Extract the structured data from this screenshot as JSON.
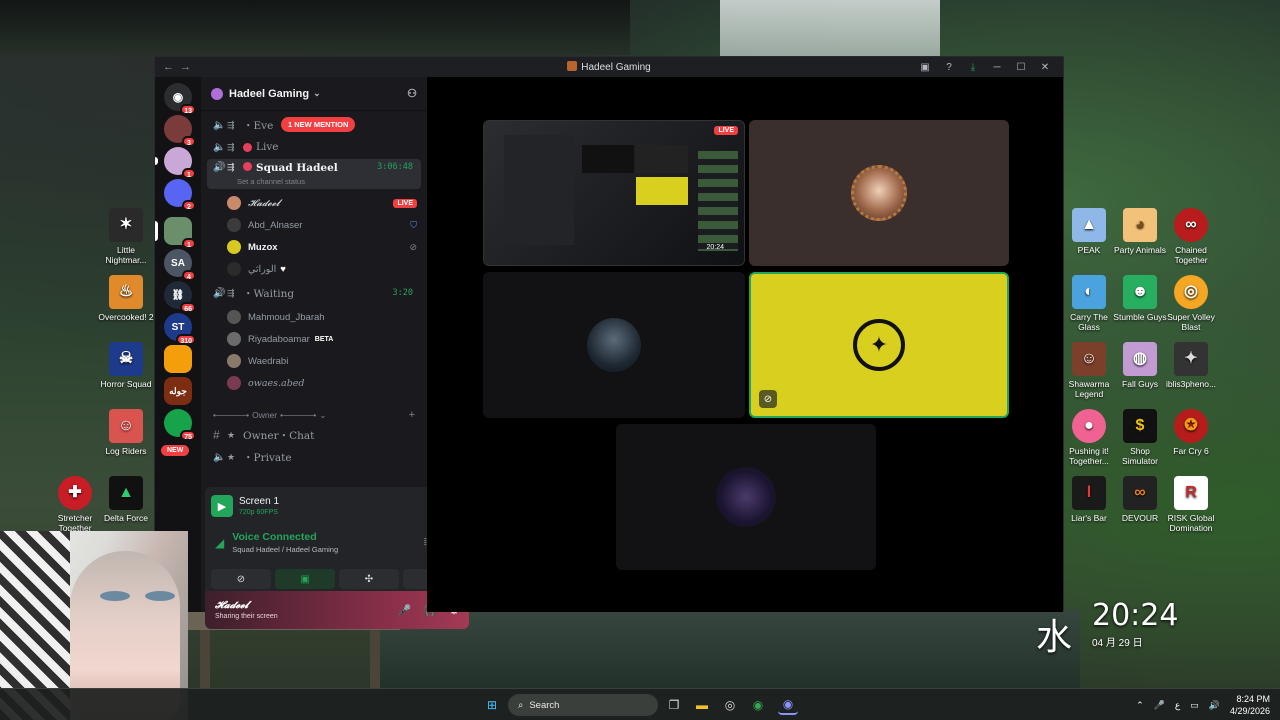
{
  "window": {
    "title": "Hadeel Gaming",
    "nav_back": "←",
    "nav_forward": "→",
    "controls": [
      "minimize",
      "maximize",
      "close"
    ]
  },
  "rail": {
    "servers": [
      {
        "label": "",
        "badge": "13",
        "color": "#5865f2"
      },
      {
        "label": "",
        "badge": "3",
        "color": "#7a3b3b"
      },
      {
        "label": "",
        "badge": "1",
        "color": "#c9a7d6"
      },
      {
        "label": "",
        "badge": "2",
        "color": "#5865f2"
      },
      {
        "label": "",
        "badge": "1",
        "color": "#6a8f6a"
      },
      {
        "label": "SA",
        "badge": "4",
        "color": "#4b5563"
      },
      {
        "label": "",
        "badge": "66",
        "color": "#1f2937"
      },
      {
        "label": "ST",
        "badge": "310",
        "color": "#1e3a8a"
      },
      {
        "label": "",
        "badge": "",
        "color": "#f59e0b"
      },
      {
        "label": "جوله",
        "badge": "",
        "color": "#7c2d12"
      },
      {
        "label": "",
        "badge": "75",
        "color": "#16a34a"
      }
    ],
    "new_label": "NEW"
  },
  "guild": {
    "name": "Hadeel Gaming",
    "mention_pill": "1 NEW MENTION",
    "channels": [
      {
        "name": "・Eve",
        "type": "voice"
      },
      {
        "name": "Live",
        "type": "voice"
      },
      {
        "name": "Squad Hadeel",
        "type": "voice",
        "time": "3:06:48",
        "status": "Set a channel status"
      },
      {
        "name": "・Waiting",
        "type": "voice",
        "time": "3:20"
      }
    ],
    "squad_members": [
      {
        "name": "𝓗𝓪𝓭𝓮𝓮𝓵",
        "badge": "LIVE"
      },
      {
        "name": "Abd_Alnaser",
        "badge": ""
      },
      {
        "name": "Muzox",
        "badge": ""
      },
      {
        "name": "الوراثي",
        "badge": ""
      }
    ],
    "waiting_members": [
      {
        "name": "Mahmoud_Jbarah"
      },
      {
        "name": "Riyadaboamar",
        "beta": "BETA"
      },
      {
        "name": "Waedrabi"
      },
      {
        "name": "owaes.abed"
      }
    ],
    "category": "Owner",
    "text_channel": "Owner・Chat",
    "private_channel": "・Private"
  },
  "voice_panel": {
    "screen_title": "Screen 1",
    "screen_quality": "720p 60FPS",
    "status": "Voice Connected",
    "location": "Squad Hadeel / Hadeel Gaming"
  },
  "user_panel": {
    "name": "𝓗𝓪𝓭𝓮𝓮𝓵",
    "status": "Sharing their screen"
  },
  "stage": {
    "live_label": "LIVE",
    "tile_time": "20:24"
  },
  "desktop_left": [
    {
      "label": "Little Nightmar...",
      "color": "#2a2a2a",
      "glyph": "✶"
    },
    {
      "label": "Overcooked! 2",
      "color": "#e08a2c",
      "glyph": "♨"
    },
    {
      "label": "Horror Squad",
      "color": "#1e3a8a",
      "glyph": "☠"
    },
    {
      "label": "Log Riders",
      "color": "#d9534f",
      "glyph": "☺"
    },
    {
      "label": "Stretcher Together",
      "color": "#c81d25",
      "glyph": "✚"
    },
    {
      "label": "Delta Force",
      "color": "#111",
      "glyph": "▲"
    }
  ],
  "desktop_right": [
    {
      "label": "PEAK",
      "color": "#8fb8e8",
      "glyph": "▲"
    },
    {
      "label": "Party Animals",
      "color": "#f2c27b",
      "glyph": "◕"
    },
    {
      "label": "Chained Together",
      "color": "#b91c1c",
      "glyph": "∞"
    },
    {
      "label": "Carry The Glass",
      "color": "#4aa3df",
      "glyph": "◐"
    },
    {
      "label": "Stumble Guys",
      "color": "#27ae60",
      "glyph": "☻"
    },
    {
      "label": "Super Volley Blast",
      "color": "#f5a623",
      "glyph": "◎"
    },
    {
      "label": "Shawarma Legend",
      "color": "#7b3f2a",
      "glyph": "☺"
    },
    {
      "label": "Fall Guys",
      "color": "#c39bd3",
      "glyph": "◍"
    },
    {
      "label": "iblis3pheno...",
      "color": "#333",
      "glyph": "✦"
    },
    {
      "label": "Pushing it! Together...",
      "color": "#f06292",
      "glyph": "●"
    },
    {
      "label": "Shop Simulator",
      "color": "#111",
      "glyph": "$"
    },
    {
      "label": "Far Cry 6",
      "color": "#b71c1c",
      "glyph": "✪"
    },
    {
      "label": "Liar's Bar",
      "color": "#1a1a1a",
      "glyph": "l"
    },
    {
      "label": "DEVOUR",
      "color": "#222",
      "glyph": "∞"
    },
    {
      "label": "RISK Global Domination",
      "color": "#fff",
      "glyph": "R"
    }
  ],
  "clock": {
    "kanji": "水",
    "time": "20:24",
    "date": "04 月 29 日"
  },
  "taskbar": {
    "search_placeholder": "Search",
    "tray_time": "8:24 PM",
    "tray_date": "4/29/2026",
    "tray_lang": "ع"
  }
}
